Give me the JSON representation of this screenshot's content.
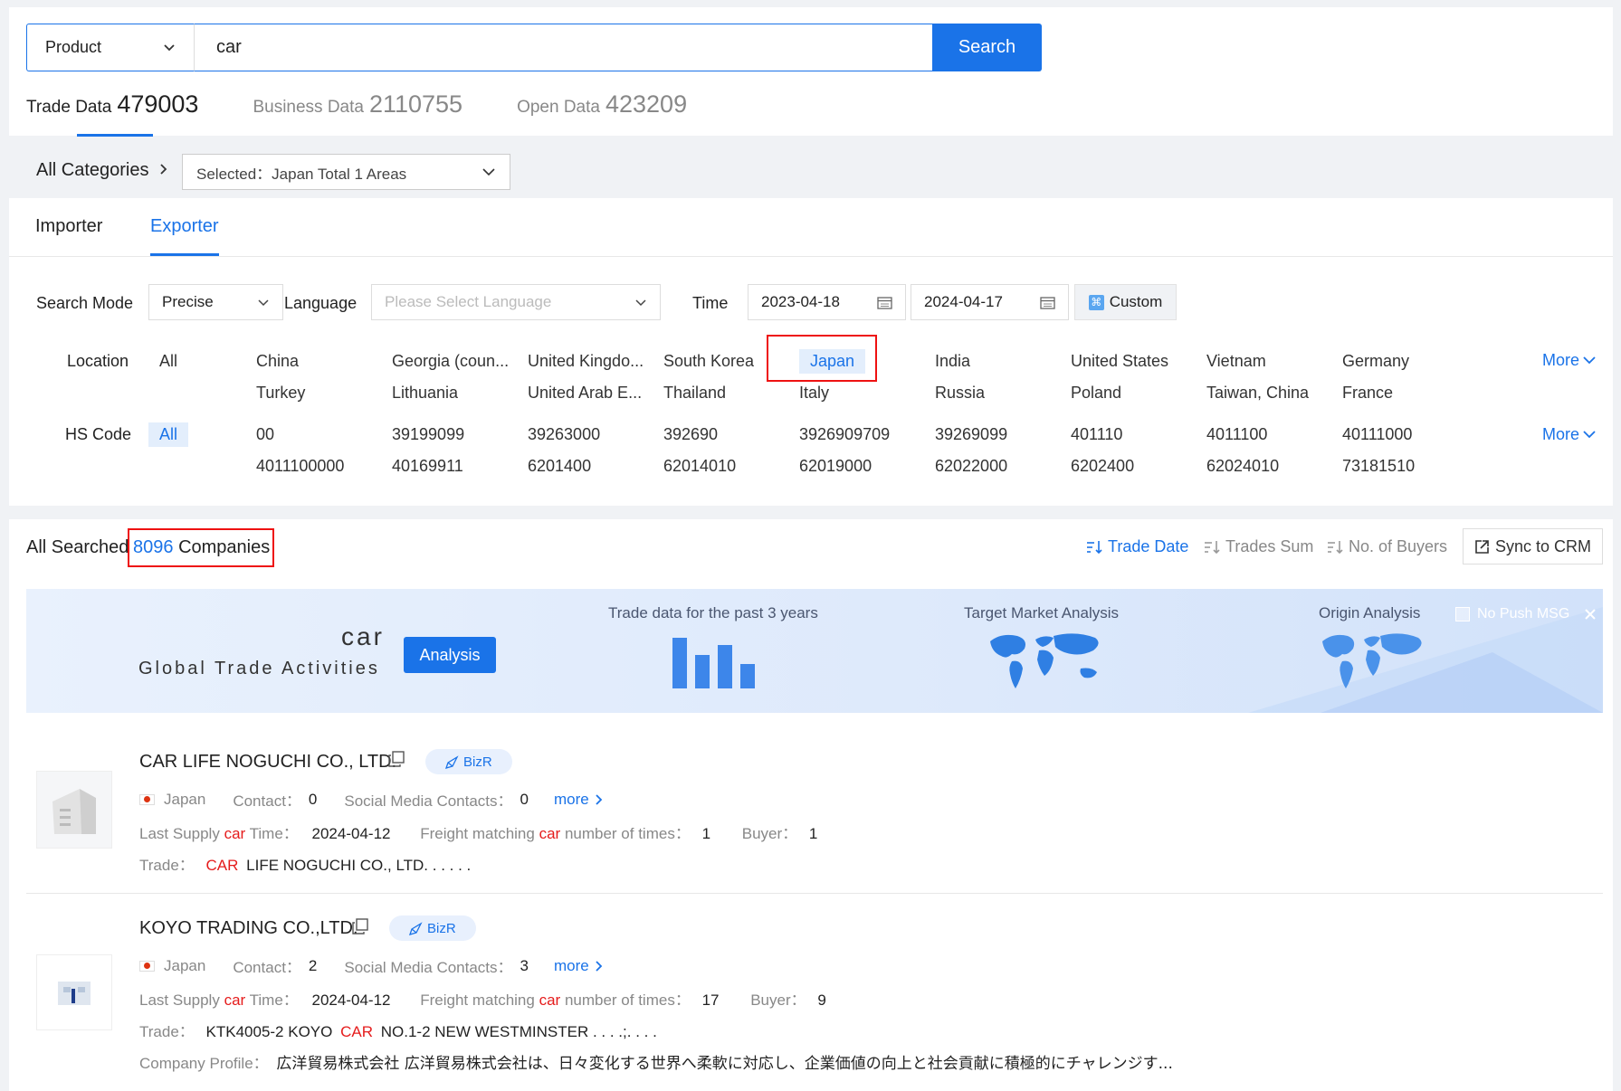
{
  "search": {
    "type_label": "Product",
    "query": "car",
    "button": "Search"
  },
  "data_tabs": [
    {
      "label": "Trade Data",
      "count": "479003"
    },
    {
      "label": "Business Data",
      "count": "2110755"
    },
    {
      "label": "Open Data",
      "count": "423209"
    }
  ],
  "categories": {
    "label": "All Categories",
    "area_select": "Selected：Japan Total 1 Areas"
  },
  "roles": {
    "importer": "Importer",
    "exporter": "Exporter"
  },
  "filters": {
    "search_mode_label": "Search Mode",
    "search_mode_value": "Precise",
    "language_label": "Language",
    "language_placeholder": "Please Select Language",
    "time_label": "Time",
    "date_from": "2023-04-18",
    "date_to": "2024-04-17",
    "custom": "Custom"
  },
  "location": {
    "label": "Location",
    "all": "All",
    "row1": [
      "China",
      "Georgia (coun...",
      "United Kingdo...",
      "South Korea",
      "Japan",
      "India",
      "United States",
      "Vietnam",
      "Germany"
    ],
    "row2": [
      "Turkey",
      "Lithuania",
      "United Arab E...",
      "Thailand",
      "Italy",
      "Russia",
      "Poland",
      "Taiwan, China",
      "France"
    ],
    "more": "More"
  },
  "hscode": {
    "label": "HS Code",
    "all": "All",
    "row1": [
      "00",
      "39199099",
      "39263000",
      "392690",
      "3926909709",
      "39269099",
      "401110",
      "4011100",
      "40111000"
    ],
    "row2": [
      "4011100000",
      "40169911",
      "6201400",
      "62014010",
      "62019000",
      "62022000",
      "6202400",
      "62024010",
      "73181510"
    ],
    "more": "More"
  },
  "results": {
    "prefix": "All Searched",
    "count": "8096",
    "suffix": "Companies"
  },
  "sort": {
    "trade_date": "Trade Date",
    "trades_sum": "Trades Sum",
    "buyers": "No. of Buyers",
    "sync": "Sync to CRM"
  },
  "banner": {
    "keyword": "car",
    "subtitle": "Global Trade Activities",
    "analysis": "Analysis",
    "trade_data": "Trade data for the past 3 years",
    "target": "Target Market Analysis",
    "origin": "Origin Analysis",
    "no_push": "No Push MSG"
  },
  "companies": [
    {
      "name": "CAR LIFE NOGUCHI CO., LTD.",
      "bizr": "BizR",
      "country": "Japan",
      "contact_label": "Contact：",
      "contact": "0",
      "social_label": "Social Media Contacts：",
      "social": "0",
      "more": "more",
      "last_supply_a": "Last Supply",
      "kw": "car",
      "last_supply_b": "Time：",
      "last_date": "2024-04-12",
      "freight_a": "Freight matching",
      "freight_b": "number of times：",
      "freight": "1",
      "buyer_label": "Buyer：",
      "buyer": "1",
      "trade_label": "Trade：",
      "trade_kw": "CAR",
      "trade_rest": "LIFE NOGUCHI CO., LTD. . . . . ."
    },
    {
      "name": "KOYO TRADING CO.,LTD.",
      "bizr": "BizR",
      "country": "Japan",
      "contact_label": "Contact：",
      "contact": "2",
      "social_label": "Social Media Contacts：",
      "social": "3",
      "more": "more",
      "last_supply_a": "Last Supply",
      "kw": "car",
      "last_supply_b": "Time：",
      "last_date": "2024-04-12",
      "freight_a": "Freight matching",
      "freight_b": "number of times：",
      "freight": "17",
      "buyer_label": "Buyer：",
      "buyer": "9",
      "trade_label": "Trade：",
      "trade_pre": "KTK4005-2 KOYO",
      "trade_kw": "CAR",
      "trade_rest": "NO.1-2 NEW WESTMINSTER . . . .;. . . .",
      "profile_label": "Company Profile：",
      "profile": "広洋貿易株式会社 広洋貿易株式会社は、日々変化する世界へ柔軟に対応し、企業価値の向上と社会貢献に積極的にチャレンジす..."
    }
  ]
}
